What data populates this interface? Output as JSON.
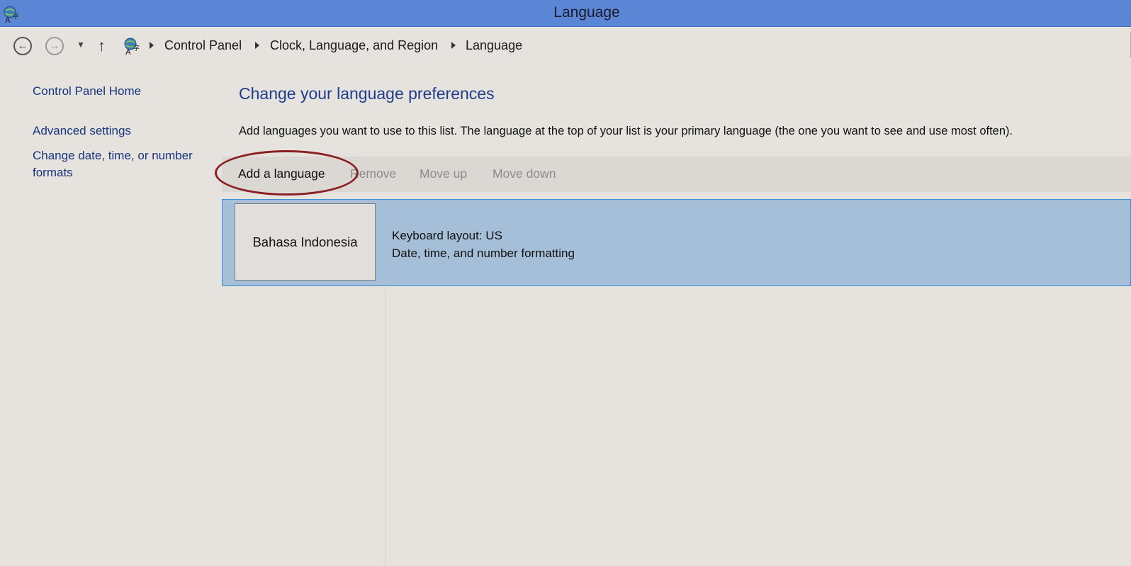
{
  "window": {
    "title": "Language"
  },
  "nav": {
    "breadcrumbs": [
      "Control Panel",
      "Clock, Language, and Region",
      "Language"
    ]
  },
  "sidebar": {
    "links": [
      "Control Panel Home",
      "Advanced settings",
      "Change date, time, or number formats"
    ]
  },
  "main": {
    "heading": "Change your language preferences",
    "description": "Add languages you want to use to this list. The language at the top of your list is your primary language (the one you want to see and use most often).",
    "toolbar": {
      "add": "Add a language",
      "remove": "Remove",
      "move_up": "Move up",
      "move_down": "Move down"
    },
    "languages": [
      {
        "name": "Bahasa Indonesia",
        "keyboard": "Keyboard layout: US",
        "formatting": "Date, time, and number formatting"
      }
    ]
  },
  "colors": {
    "titlebar": "#5b86d6",
    "link": "#18357d",
    "heading": "#1f3d8a",
    "selected_row": "#a6bfd8",
    "annotation_circle": "#8b1e23"
  }
}
